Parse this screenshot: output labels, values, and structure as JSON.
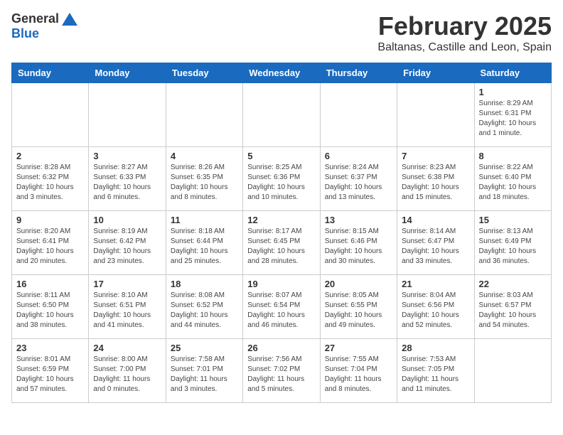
{
  "logo": {
    "general": "General",
    "blue": "Blue"
  },
  "title": "February 2025",
  "location": "Baltanas, Castille and Leon, Spain",
  "days_header": [
    "Sunday",
    "Monday",
    "Tuesday",
    "Wednesday",
    "Thursday",
    "Friday",
    "Saturday"
  ],
  "weeks": [
    [
      {
        "day": "",
        "info": ""
      },
      {
        "day": "",
        "info": ""
      },
      {
        "day": "",
        "info": ""
      },
      {
        "day": "",
        "info": ""
      },
      {
        "day": "",
        "info": ""
      },
      {
        "day": "",
        "info": ""
      },
      {
        "day": "1",
        "info": "Sunrise: 8:29 AM\nSunset: 6:31 PM\nDaylight: 10 hours\nand 1 minute."
      }
    ],
    [
      {
        "day": "2",
        "info": "Sunrise: 8:28 AM\nSunset: 6:32 PM\nDaylight: 10 hours\nand 3 minutes."
      },
      {
        "day": "3",
        "info": "Sunrise: 8:27 AM\nSunset: 6:33 PM\nDaylight: 10 hours\nand 6 minutes."
      },
      {
        "day": "4",
        "info": "Sunrise: 8:26 AM\nSunset: 6:35 PM\nDaylight: 10 hours\nand 8 minutes."
      },
      {
        "day": "5",
        "info": "Sunrise: 8:25 AM\nSunset: 6:36 PM\nDaylight: 10 hours\nand 10 minutes."
      },
      {
        "day": "6",
        "info": "Sunrise: 8:24 AM\nSunset: 6:37 PM\nDaylight: 10 hours\nand 13 minutes."
      },
      {
        "day": "7",
        "info": "Sunrise: 8:23 AM\nSunset: 6:38 PM\nDaylight: 10 hours\nand 15 minutes."
      },
      {
        "day": "8",
        "info": "Sunrise: 8:22 AM\nSunset: 6:40 PM\nDaylight: 10 hours\nand 18 minutes."
      }
    ],
    [
      {
        "day": "9",
        "info": "Sunrise: 8:20 AM\nSunset: 6:41 PM\nDaylight: 10 hours\nand 20 minutes."
      },
      {
        "day": "10",
        "info": "Sunrise: 8:19 AM\nSunset: 6:42 PM\nDaylight: 10 hours\nand 23 minutes."
      },
      {
        "day": "11",
        "info": "Sunrise: 8:18 AM\nSunset: 6:44 PM\nDaylight: 10 hours\nand 25 minutes."
      },
      {
        "day": "12",
        "info": "Sunrise: 8:17 AM\nSunset: 6:45 PM\nDaylight: 10 hours\nand 28 minutes."
      },
      {
        "day": "13",
        "info": "Sunrise: 8:15 AM\nSunset: 6:46 PM\nDaylight: 10 hours\nand 30 minutes."
      },
      {
        "day": "14",
        "info": "Sunrise: 8:14 AM\nSunset: 6:47 PM\nDaylight: 10 hours\nand 33 minutes."
      },
      {
        "day": "15",
        "info": "Sunrise: 8:13 AM\nSunset: 6:49 PM\nDaylight: 10 hours\nand 36 minutes."
      }
    ],
    [
      {
        "day": "16",
        "info": "Sunrise: 8:11 AM\nSunset: 6:50 PM\nDaylight: 10 hours\nand 38 minutes."
      },
      {
        "day": "17",
        "info": "Sunrise: 8:10 AM\nSunset: 6:51 PM\nDaylight: 10 hours\nand 41 minutes."
      },
      {
        "day": "18",
        "info": "Sunrise: 8:08 AM\nSunset: 6:52 PM\nDaylight: 10 hours\nand 44 minutes."
      },
      {
        "day": "19",
        "info": "Sunrise: 8:07 AM\nSunset: 6:54 PM\nDaylight: 10 hours\nand 46 minutes."
      },
      {
        "day": "20",
        "info": "Sunrise: 8:05 AM\nSunset: 6:55 PM\nDaylight: 10 hours\nand 49 minutes."
      },
      {
        "day": "21",
        "info": "Sunrise: 8:04 AM\nSunset: 6:56 PM\nDaylight: 10 hours\nand 52 minutes."
      },
      {
        "day": "22",
        "info": "Sunrise: 8:03 AM\nSunset: 6:57 PM\nDaylight: 10 hours\nand 54 minutes."
      }
    ],
    [
      {
        "day": "23",
        "info": "Sunrise: 8:01 AM\nSunset: 6:59 PM\nDaylight: 10 hours\nand 57 minutes."
      },
      {
        "day": "24",
        "info": "Sunrise: 8:00 AM\nSunset: 7:00 PM\nDaylight: 11 hours\nand 0 minutes."
      },
      {
        "day": "25",
        "info": "Sunrise: 7:58 AM\nSunset: 7:01 PM\nDaylight: 11 hours\nand 3 minutes."
      },
      {
        "day": "26",
        "info": "Sunrise: 7:56 AM\nSunset: 7:02 PM\nDaylight: 11 hours\nand 5 minutes."
      },
      {
        "day": "27",
        "info": "Sunrise: 7:55 AM\nSunset: 7:04 PM\nDaylight: 11 hours\nand 8 minutes."
      },
      {
        "day": "28",
        "info": "Sunrise: 7:53 AM\nSunset: 7:05 PM\nDaylight: 11 hours\nand 11 minutes."
      },
      {
        "day": "",
        "info": ""
      }
    ]
  ]
}
